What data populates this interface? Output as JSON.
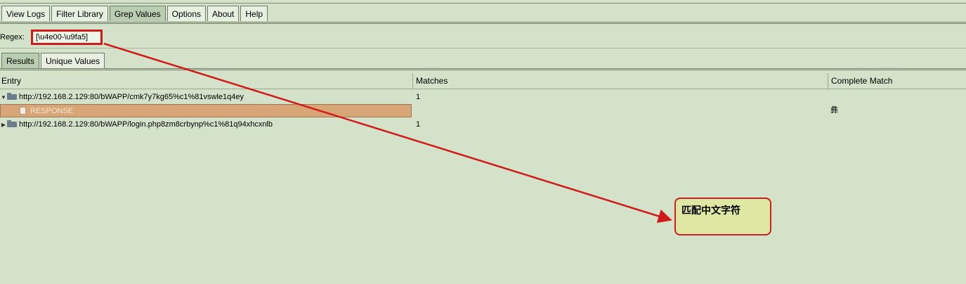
{
  "tabs": [
    "View Logs",
    "Filter Library",
    "Grep Values",
    "Options",
    "About",
    "Help"
  ],
  "active_tab": "Grep Values",
  "regex": {
    "label": "Regex:",
    "value": "[\\u4e00-\\u9fa5]"
  },
  "subtabs": [
    "Results",
    "Unique Values"
  ],
  "active_subtab": "Results",
  "table": {
    "columns": [
      "Entry",
      "Matches",
      "Complete Match"
    ],
    "rows": [
      {
        "entry": "http://192.168.2.129:80/bWAPP/cmk7y7kg65%c1%81vswle1q4ey",
        "matches": "1",
        "complete": ""
      },
      {
        "entry": "RESPONSE",
        "matches": "",
        "complete": "彝"
      },
      {
        "entry": "http://192.168.2.129:80/bWAPP/login.php8zm8crbynp%c1%81q94xhcxnlb",
        "matches": "1",
        "complete": ""
      }
    ]
  },
  "callout": {
    "text": "匹配中文字符"
  },
  "colors": {
    "background": "#d3e2c9",
    "highlight": "#d11a1a",
    "callout_fill": "#dfe8a2",
    "selected_row": "#d8a676"
  }
}
